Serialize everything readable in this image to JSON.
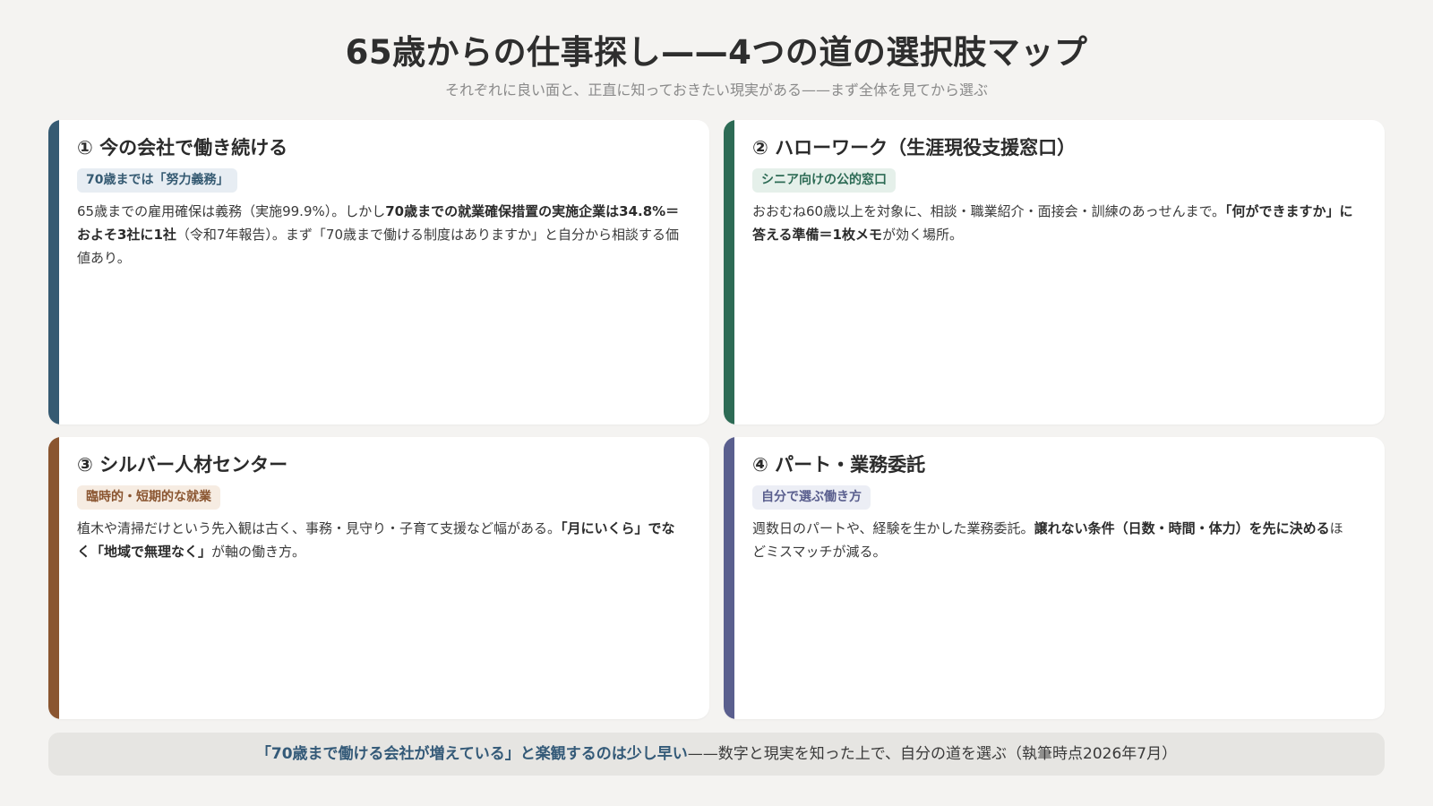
{
  "title": "65歳からの仕事探し——4つの道の選択肢マップ",
  "subtitle": "それぞれに良い面と、正直に知っておきたい現実がある——まず全体を見てから選ぶ",
  "cards": [
    {
      "title": "① 今の会社で働き続ける",
      "tag": "70歳までは「努力義務」",
      "accent": "#355a72",
      "tag_bg": "#e7edf3",
      "tag_color": "#355a72",
      "desc": [
        {
          "t": "65歳までの雇用確保は義務（実施99.9%）。しかし",
          "b": false
        },
        {
          "t": "70歳までの就業確保措置の実施企業は34.8%＝およそ3社に1社",
          "b": true
        },
        {
          "t": "（令和7年報告）。まず「70歳まで働ける制度はありますか」と自分から相談する価値あり。",
          "b": false
        }
      ]
    },
    {
      "title": "② ハローワーク（生涯現役支援窓口）",
      "tag": "シニア向けの公的窓口",
      "accent": "#2d6b55",
      "tag_bg": "#e5f0ea",
      "tag_color": "#2d6b55",
      "desc": [
        {
          "t": "おおむね60歳以上を対象に、相談・職業紹介・面接会・訓練のあっせんまで。",
          "b": false
        },
        {
          "t": "「何ができますか」に答える準備＝1枚メモ",
          "b": true
        },
        {
          "t": "が効く場所。",
          "b": false
        }
      ]
    },
    {
      "title": "③ シルバー人材センター",
      "tag": "臨時的・短期的な就業",
      "accent": "#8a5530",
      "tag_bg": "#f6ece2",
      "tag_color": "#8a5530",
      "desc": [
        {
          "t": "植木や清掃だけという先入観は古く、事務・見守り・子育て支援など幅がある。",
          "b": false
        },
        {
          "t": "「月にいくら」でなく「地域で無理なく」",
          "b": true
        },
        {
          "t": "が軸の働き方。",
          "b": false
        }
      ]
    },
    {
      "title": "④ パート・業務委託",
      "tag": "自分で選ぶ働き方",
      "accent": "#5a5f8e",
      "tag_bg": "#eceef5",
      "tag_color": "#5a5f8e",
      "desc": [
        {
          "t": "週数日のパートや、経験を生かした業務委託。",
          "b": false
        },
        {
          "t": "譲れない条件（日数・時間・体力）を先に決める",
          "b": true
        },
        {
          "t": "ほどミスマッチが減る。",
          "b": false
        }
      ]
    }
  ],
  "footer": {
    "highlight": "「70歳まで働ける会社が増えている」と楽観するのは少し早い",
    "rest": "——数字と現実を知った上で、自分の道を選ぶ（執筆時点2026年7月）"
  }
}
